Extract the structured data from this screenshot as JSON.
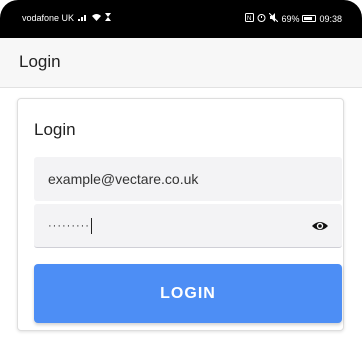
{
  "status_bar": {
    "carrier": "vodafone UK",
    "battery_percent": "69%",
    "time": "09:38",
    "icons": [
      "signal-icon",
      "wifi-icon",
      "hourglass-icon",
      "nfc-icon",
      "alarm-icon",
      "mute-icon",
      "battery-icon"
    ]
  },
  "app_bar": {
    "title": "Login"
  },
  "login_card": {
    "title": "Login",
    "email_value": "example@vectare.co.uk",
    "password_masked": "·········",
    "show_password_icon": "eye-icon",
    "login_button_label": "LOGIN"
  },
  "colors": {
    "primary_button": "#4d8ef5",
    "status_bar_bg": "#000000",
    "app_bar_bg": "#f7f7f7",
    "field_bg": "#f3f3f5"
  }
}
